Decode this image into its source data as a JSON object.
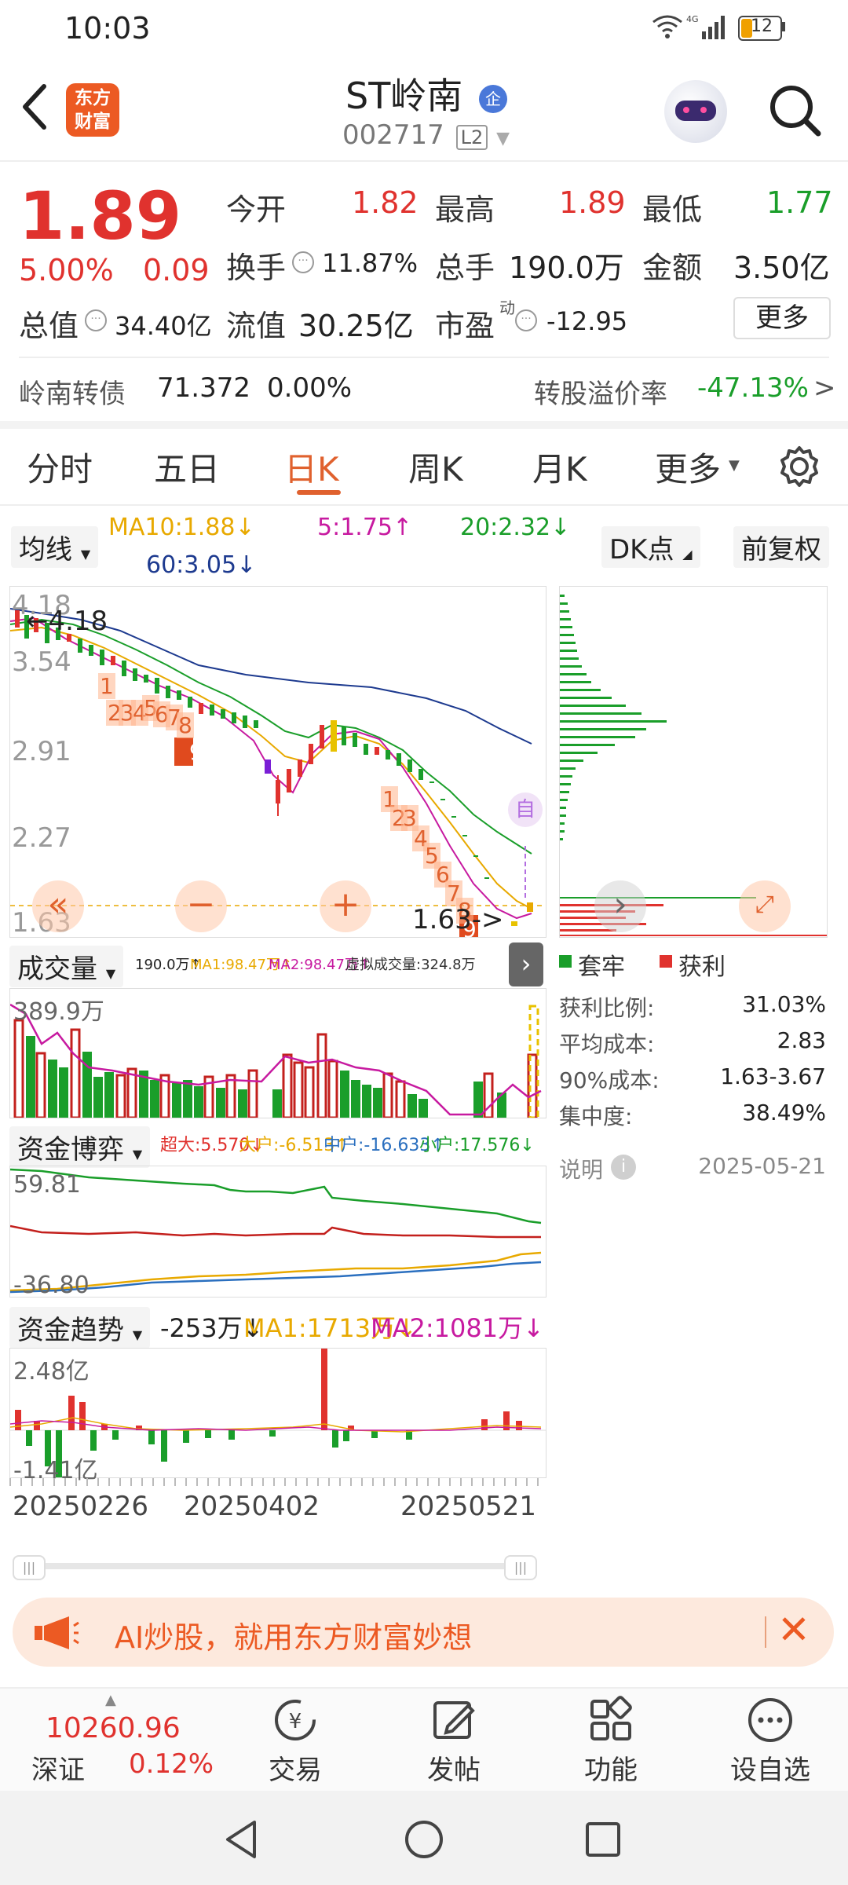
{
  "status_bar": {
    "time": "10:03",
    "battery": "12"
  },
  "header": {
    "stock_name": "ST岭南",
    "badge": "企",
    "code": "002717",
    "level": "L2",
    "brand_line1": "东方",
    "brand_line2": "财富"
  },
  "quote": {
    "price": "1.89",
    "change_pct": "5.00%",
    "change": "0.09",
    "open_label": "今开",
    "open": "1.82",
    "high_label": "最高",
    "high": "1.89",
    "low_label": "最低",
    "low": "1.77",
    "turnover_label": "换手",
    "turnover": "11.87%",
    "volume_label": "总手",
    "volume": "190.0万",
    "amount_label": "金额",
    "amount": "3.50亿",
    "mktcap_label": "总值",
    "mktcap": "34.40亿",
    "float_label": "流值",
    "float": "30.25亿",
    "pe_label": "市盈",
    "pe_sup": "动",
    "pe": "-12.95",
    "more_label": "更多"
  },
  "bond": {
    "label": "岭南转债",
    "price": "71.372",
    "pct": "0.00%",
    "premium_label": "转股溢价率",
    "premium": "-47.13%"
  },
  "tabs": {
    "t1": "分时",
    "t2": "五日",
    "t3": "日K",
    "t4": "周K",
    "t5": "月K",
    "t6": "更多"
  },
  "ma_bar": {
    "selector": "均线",
    "ma10": "MA10:1.88↓",
    "ma5": "5:1.75↑",
    "ma20": "20:2.32↓",
    "ma60": "60:3.05↓",
    "dk": "DK点",
    "adjust": "前复权"
  },
  "kline": {
    "y_top": "4.18",
    "y_2": "3.54",
    "y_3": "2.91",
    "y_4": "2.27",
    "y_bottom": "1.63",
    "high_marker": "←4.18",
    "low_marker": "1.63->",
    "self_label": "自",
    "seq_a": [
      "1",
      "2",
      "3",
      "4",
      "5",
      "6",
      "7",
      "8",
      "9"
    ],
    "seq_b": [
      "1",
      "2",
      "3",
      "4",
      "5",
      "6",
      "7",
      "8",
      "9"
    ]
  },
  "volume_panel": {
    "selector": "成交量",
    "legend": "190.0万↑",
    "ma1": "MA1:98.47万↑",
    "ma2": "MA2:98.47万↑",
    "virtual": "虚拟成交量:324.8万",
    "y_top": "389.9万"
  },
  "fund_game": {
    "selector": "资金博弈",
    "super": "超大:5.570↓",
    "big": "大户:-6.513↑",
    "mid": "中户:-16.633↑",
    "small": "小户:17.576↓",
    "y_top": "59.81",
    "y_bottom": "-36.80"
  },
  "fund_trend": {
    "selector": "资金趋势",
    "value": "-253万↓",
    "ma1": "MA1:1713万↓",
    "ma2": "MA2:1081万↓",
    "y_top": "2.48亿",
    "y_bottom": "-1.41亿"
  },
  "dates": {
    "d1": "20250226",
    "d2": "20250402",
    "d3": "20250521"
  },
  "chip": {
    "legend_trapped": "套牢",
    "legend_profit": "获利",
    "rows": [
      {
        "label": "获利比例:",
        "value": "31.03%"
      },
      {
        "label": "平均成本:",
        "value": "2.83"
      },
      {
        "label": "90%成本:",
        "value": "1.63-3.67"
      },
      {
        "label": "集中度:",
        "value": "38.49%"
      }
    ],
    "note_label": "说明",
    "date": "2025-05-21"
  },
  "banner": {
    "text": "AI炒股，就用东方财富妙想"
  },
  "bottom_nav": {
    "index_value": "10260.96",
    "index_name": "深证",
    "index_pct": "0.12%",
    "trade": "交易",
    "post": "发帖",
    "functions": "功能",
    "watchlist": "设自选"
  },
  "colors": {
    "accent": "#e0612e",
    "up": "#e0322e",
    "down": "#1a9e2a",
    "ma5": "#c71aa0",
    "ma10": "#e8a900",
    "ma20": "#1a9e2a",
    "ma60": "#1d3a8f"
  }
}
